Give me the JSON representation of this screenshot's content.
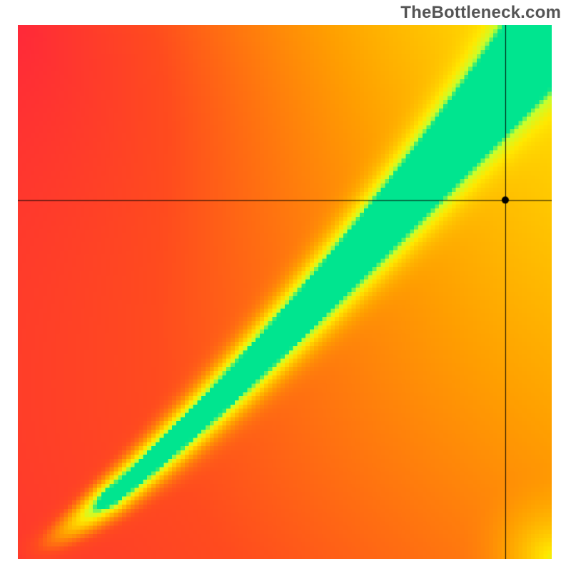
{
  "watermark": {
    "text": "TheBottleneck.com"
  },
  "chart_data": {
    "type": "heatmap",
    "title": "",
    "xlabel": "",
    "ylabel": "",
    "xlim": [
      0,
      1
    ],
    "ylim": [
      0,
      1
    ],
    "grid": false,
    "legend": false,
    "resolution": 128,
    "color_stops": [
      {
        "t": 0.0,
        "color": "#ff2040"
      },
      {
        "t": 0.3,
        "color": "#ff4b1e"
      },
      {
        "t": 0.55,
        "color": "#ff9f00"
      },
      {
        "t": 0.78,
        "color": "#ffe800"
      },
      {
        "t": 0.91,
        "color": "#c6ff2e"
      },
      {
        "t": 1.0,
        "color": "#00e58f"
      }
    ],
    "ridge": {
      "description": "green optimal band runs along y = x^1.23 from origin to top-right; score falls off with distance from that curve",
      "exponent": 1.23,
      "band_halfwidth": 0.055,
      "corner_boost_radius": 0.18
    },
    "crosshair": {
      "x": 0.913,
      "y": 0.672,
      "dot_radius_px": 5
    }
  }
}
